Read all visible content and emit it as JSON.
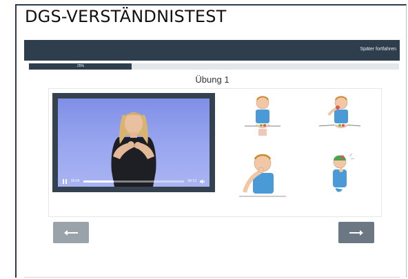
{
  "page": {
    "title": "DGS-VERSTÄNDNISTEST"
  },
  "topbar": {
    "later_label": "Später fortfahren",
    "color": "#2f3e4d"
  },
  "progress": {
    "label": "25%",
    "fraction": 0.25
  },
  "exercise": {
    "title": "Übung 1"
  },
  "video": {
    "current_time": "00:04",
    "duration": "00:13",
    "played_fraction": 0.3,
    "icons": {
      "play_pause": "pause-icon",
      "volume": "volume-icon"
    }
  },
  "answer_options": [
    {
      "icon": "sign-illustration-1"
    },
    {
      "icon": "sign-illustration-2"
    },
    {
      "icon": "sign-illustration-3"
    },
    {
      "icon": "sign-illustration-4"
    }
  ],
  "navigation": {
    "back_icon": "arrow-left-icon",
    "next_icon": "arrow-right-icon"
  }
}
